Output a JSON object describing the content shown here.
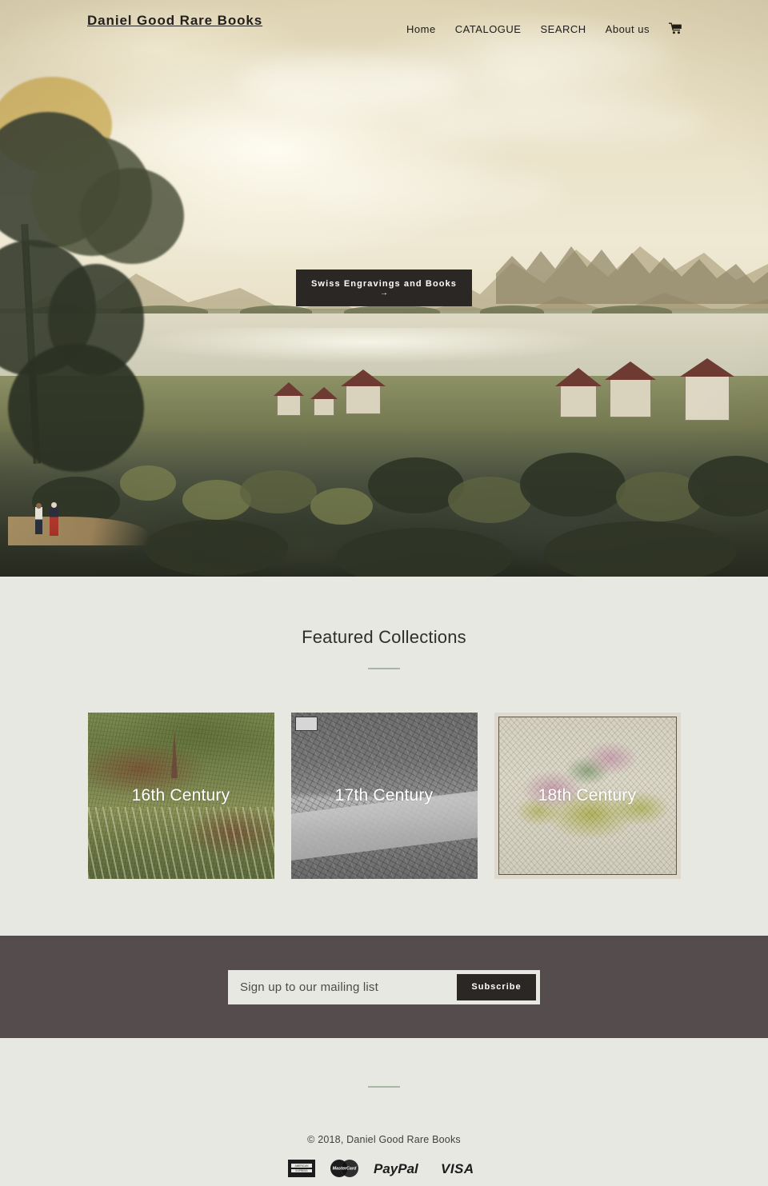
{
  "header": {
    "brand": "Daniel Good Rare Books",
    "nav": [
      {
        "label": "Home",
        "name": "nav-home"
      },
      {
        "label": "CATALOGUE",
        "name": "nav-catalogue"
      },
      {
        "label": "SEARCH",
        "name": "nav-search"
      },
      {
        "label": "About us",
        "name": "nav-about-us"
      }
    ],
    "cart_icon": "shopping-cart-icon"
  },
  "hero": {
    "cta_label": "Swiss Engravings and Books",
    "cta_arrow": "→",
    "image_description": "Sepia-toned antique Swiss lake landscape with mountains, village and two figures"
  },
  "featured": {
    "title": "Featured Collections",
    "cards": [
      {
        "label": "16th Century",
        "name": "collection-card-16th-century"
      },
      {
        "label": "17th Century",
        "name": "collection-card-17th-century"
      },
      {
        "label": "18th Century",
        "name": "collection-card-18th-century"
      }
    ]
  },
  "newsletter": {
    "placeholder": "Sign up to our mailing list",
    "value": "",
    "button_label": "Subscribe"
  },
  "footer": {
    "copyright": "© 2018, Daniel Good Rare Books",
    "payment_methods": [
      {
        "name": "american-express-icon",
        "label": "AMERICAN EXPRESS"
      },
      {
        "name": "mastercard-icon",
        "label": "MasterCard"
      },
      {
        "name": "paypal-icon",
        "label": "PayPal"
      },
      {
        "name": "visa-icon",
        "label": "VISA"
      }
    ]
  },
  "colors": {
    "page_background": "#e8e8e2",
    "newsletter_background": "#554d4d",
    "button_dark": "#2b2724",
    "rule_green": "#a9b7a6",
    "text": "#3b3b3b"
  }
}
